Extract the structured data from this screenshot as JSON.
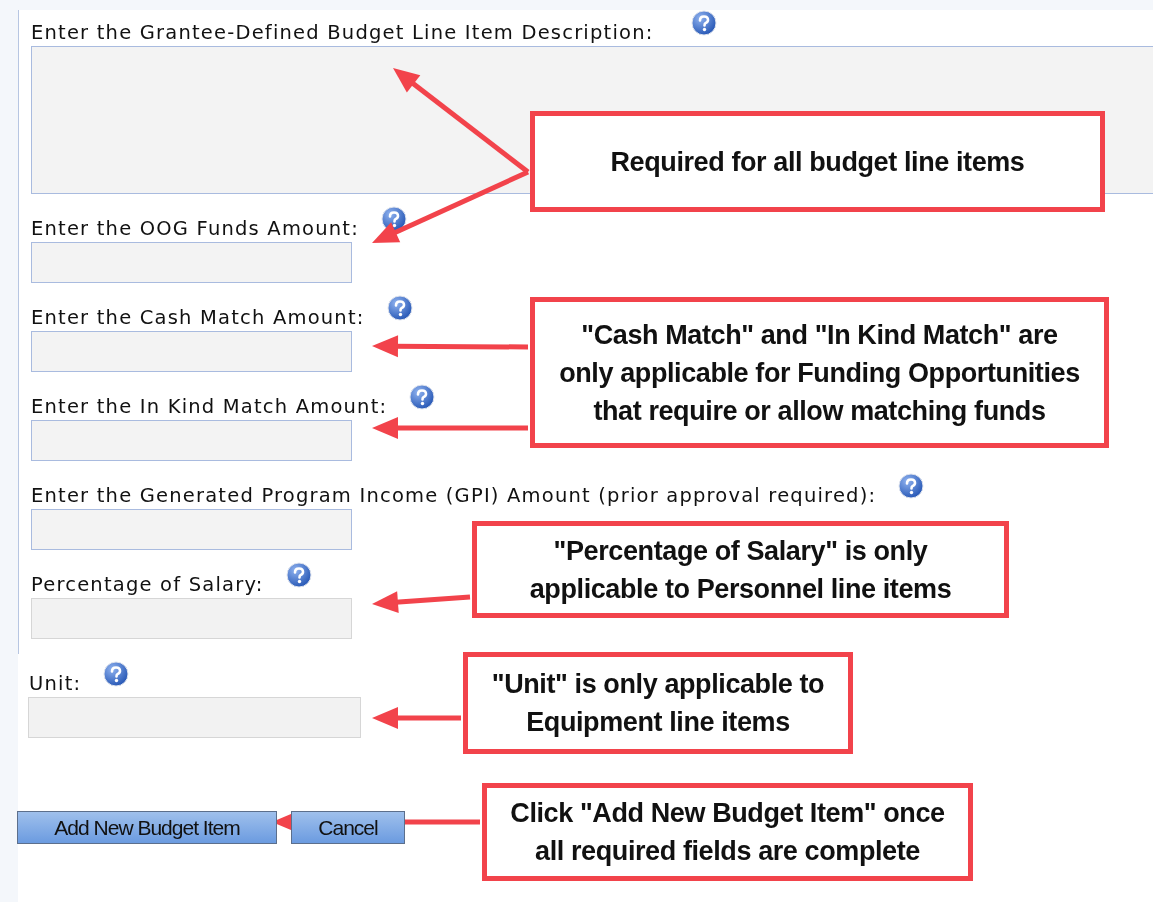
{
  "fields": [
    {
      "label": "Enter the Grantee-Defined Budget Line Item Description:",
      "kind": "textarea",
      "disabled": false
    },
    {
      "label": "Enter the OOG Funds Amount:",
      "kind": "input",
      "disabled": false
    },
    {
      "label": "Enter the Cash Match Amount:",
      "kind": "input",
      "disabled": false
    },
    {
      "label": "Enter the In Kind Match Amount:",
      "kind": "input",
      "disabled": false
    },
    {
      "label": "Enter the Generated Program Income (GPI) Amount (prior approval required):",
      "kind": "input",
      "disabled": false
    },
    {
      "label": "Percentage of Salary:",
      "kind": "input",
      "disabled": true
    }
  ],
  "unit": {
    "label": "Unit:",
    "disabled": true
  },
  "buttons": [
    "Add New Budget Item",
    "Cancel"
  ],
  "callouts": [
    {
      "text": "Required for all budget line items"
    },
    {
      "text": "\"Cash Match\" and \"In Kind Match\" are\nonly applicable for Funding Opportunities\nthat require or allow matching funds"
    },
    {
      "text": "\"Percentage of Salary\" is only\napplicable to Personnel line items"
    },
    {
      "text": "\"Unit\" is only applicable to\nEquipment line items"
    },
    {
      "text": "Click \"Add New Budget Item\" once\nall required fields are complete"
    }
  ]
}
